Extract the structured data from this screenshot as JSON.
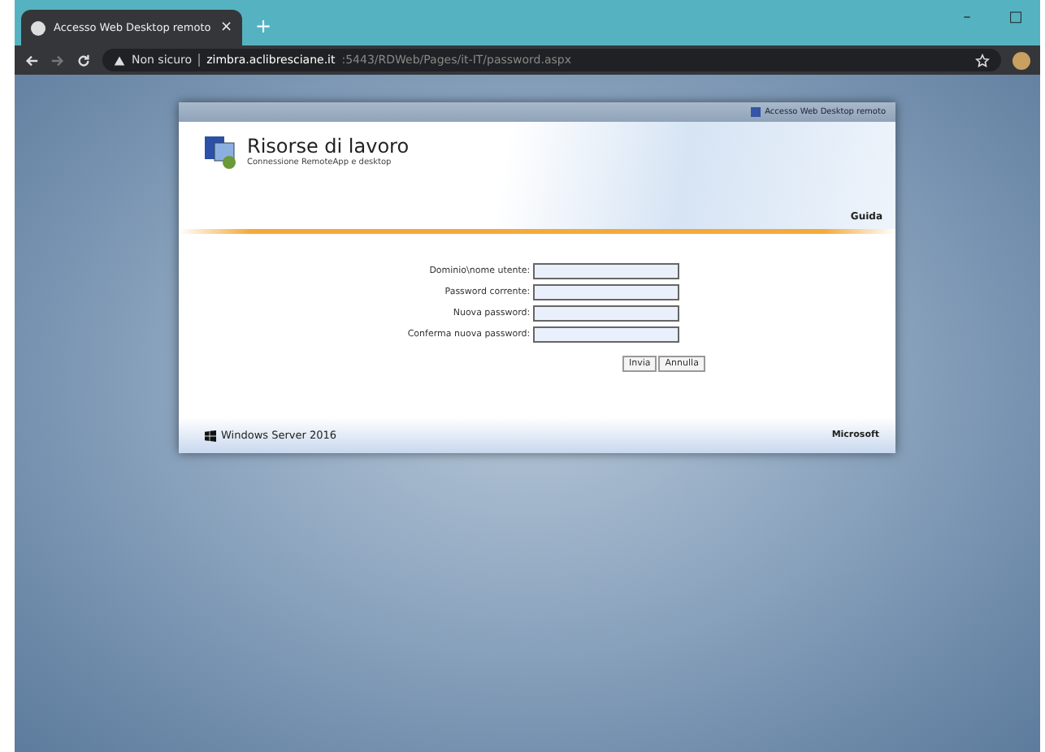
{
  "browser": {
    "tab_title": "Accesso Web Desktop remoto",
    "tab_close": "×",
    "new_tab": "+",
    "minimize": "–",
    "maximize": "□",
    "security": "Non sicuro",
    "url_host": "zimbra.aclibresciane.it",
    "url_path": ":5443/RDWeb/Pages/it-IT/password.aspx"
  },
  "dialog": {
    "top_link": "Accesso Web Desktop remoto",
    "title": "Risorse di lavoro",
    "subtitle": "Connessione RemoteApp e desktop",
    "help": "Guida",
    "fields": [
      {
        "label": "Dominio\\nome utente:"
      },
      {
        "label": "Password corrente:"
      },
      {
        "label": "Nuova password:"
      },
      {
        "label": "Conferma nuova password:"
      }
    ],
    "buttons": [
      "Invia",
      "Annulla"
    ],
    "footer_product": "Windows Server 2016",
    "footer_brand": "Microsoft"
  }
}
